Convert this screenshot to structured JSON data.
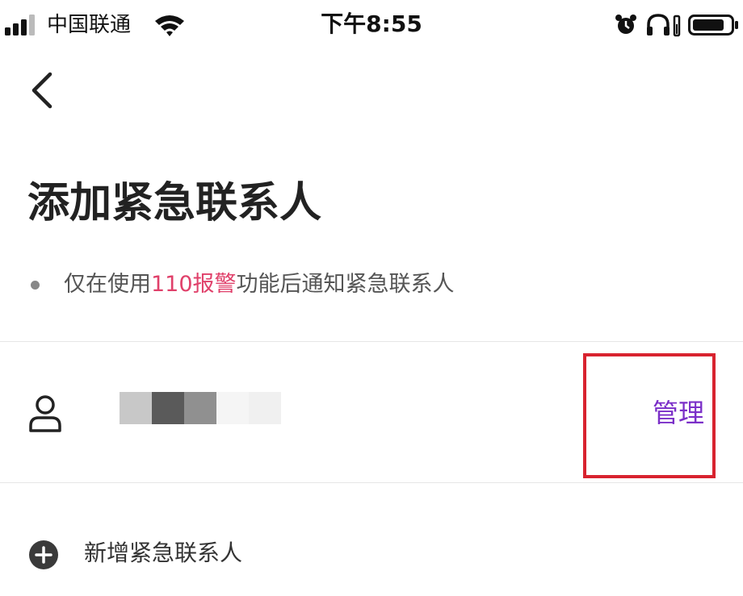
{
  "status_bar": {
    "carrier": "中国联通",
    "time": "下午8:55",
    "icons": [
      "signal-icon",
      "wifi-icon",
      "alarm-icon",
      "headphones-icon",
      "battery-icon"
    ]
  },
  "nav": {
    "back_icon": "chevron-left-icon"
  },
  "page": {
    "title": "添加紧急联系人",
    "note_prefix": "仅在使用",
    "note_highlight": "110报警",
    "note_suffix": "功能后通知紧急联系人"
  },
  "contact": {
    "icon": "person-icon",
    "name_redacted": true,
    "manage_label": "管理"
  },
  "add_contact": {
    "icon": "plus-circle-icon",
    "label": "新增紧急联系人"
  },
  "colors": {
    "highlight_text": "#e0406a",
    "manage_link": "#7b2fc8",
    "annotation_box": "#d8232f"
  }
}
